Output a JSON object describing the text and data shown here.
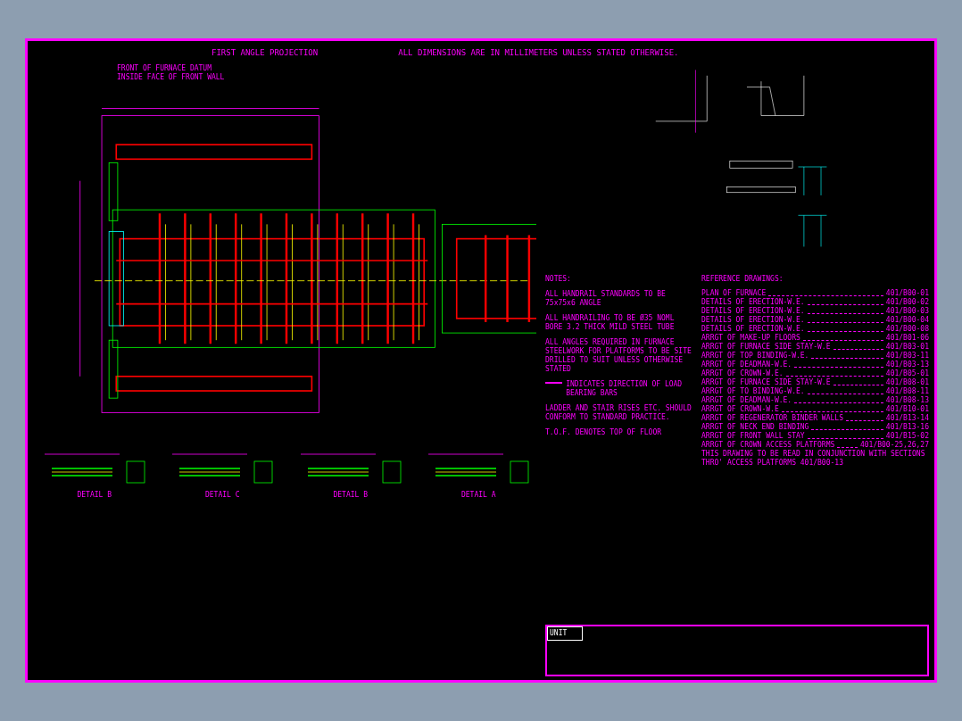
{
  "header": {
    "projection": "FIRST ANGLE PROJECTION",
    "dimensions_note": "ALL DIMENSIONS ARE IN MILLIMETERS UNLESS STATED OTHERWISE."
  },
  "plan": {
    "datum_note": [
      "FRONT OF FURNACE DATUM",
      "INSIDE FACE OF FRONT WALL"
    ]
  },
  "details": [
    {
      "label": "DETAIL B"
    },
    {
      "label": "DETAIL C"
    },
    {
      "label": "DETAIL B"
    },
    {
      "label": "DETAIL A"
    }
  ],
  "notes": {
    "heading": "NOTES:",
    "items": [
      {
        "kind": "text",
        "text": "ALL HANDRAIL STANDARDS TO BE 75x75x6 ANGLE"
      },
      {
        "kind": "text",
        "text": "ALL HANDRAILING TO BE Ø35 NOML BORE 3.2 THICK MILD STEEL TUBE"
      },
      {
        "kind": "text",
        "text": "ALL ANGLES REQUIRED IN FURNACE STEELWORK FOR PLATFORMS TO BE SITE DRILLED TO SUIT UNLESS OTHERWISE STATED"
      },
      {
        "kind": "legend",
        "text": "INDICATES DIRECTION OF LOAD BEARING BARS"
      },
      {
        "kind": "text",
        "text": "LADDER AND STAIR RISES ETC. SHOULD CONFORM TO STANDARD PRACTICE."
      },
      {
        "kind": "text",
        "text": "T.O.F. DENOTES TOP OF FLOOR"
      }
    ]
  },
  "references": {
    "heading": "REFERENCE DRAWINGS:",
    "items": [
      {
        "title": "PLAN OF FURNACE",
        "number": "401/B00-01"
      },
      {
        "title": "DETAILS OF ERECTION-W.E.",
        "number": "401/B00-02"
      },
      {
        "title": "DETAILS OF ERECTION-W.E.",
        "number": "401/B00-03"
      },
      {
        "title": "DETAILS OF ERECTION-W.E.",
        "number": "401/B00-04"
      },
      {
        "title": "DETAILS OF ERECTION-W.E.",
        "number": "401/B00-08"
      },
      {
        "title": "ARRGT OF MAKE-UP FLOORS",
        "number": "401/B01-06"
      },
      {
        "title": "ARRGT OF FURNACE SIDE STAY-W.E",
        "number": "401/B03-01"
      },
      {
        "title": "ARRGT OF TOP BINDING-W.E.",
        "number": "401/B03-11"
      },
      {
        "title": "ARRGT OF DEADMAN-W.E.",
        "number": "401/B03-13"
      },
      {
        "title": "ARRGT OF CROWN-W.E.",
        "number": "401/B05-01"
      },
      {
        "title": "ARRGT OF FURNACE SIDE STAY-W.E",
        "number": "401/B08-01"
      },
      {
        "title": "ARRGT OF TO BINDING-W.E.",
        "number": "401/B08-11"
      },
      {
        "title": "ARRGT OF DEADMAN-W.E.",
        "number": "401/B08-13"
      },
      {
        "title": "ARRGT OF CROWN-W.E",
        "number": "401/B10-01"
      },
      {
        "title": "ARRGT OF REGENERATOR BINDER WALLS",
        "number": "401/B13-14"
      },
      {
        "title": "ARRGT OF NECK END BINDING",
        "number": "401/B13-16"
      },
      {
        "title": "ARRGT OF FRONT WALL STAY",
        "number": "401/B15-02"
      },
      {
        "title": "ARRGT OF CROWN ACCESS PLATFORMS",
        "number": "401/B00-25,26,27"
      }
    ],
    "footer": "THIS DRAWING TO BE READ IN CONJUNCTION WITH SECTIONS THRO' ACCESS PLATFORMS 401/B00-13"
  },
  "title_block": {
    "unit": "UNIT"
  }
}
